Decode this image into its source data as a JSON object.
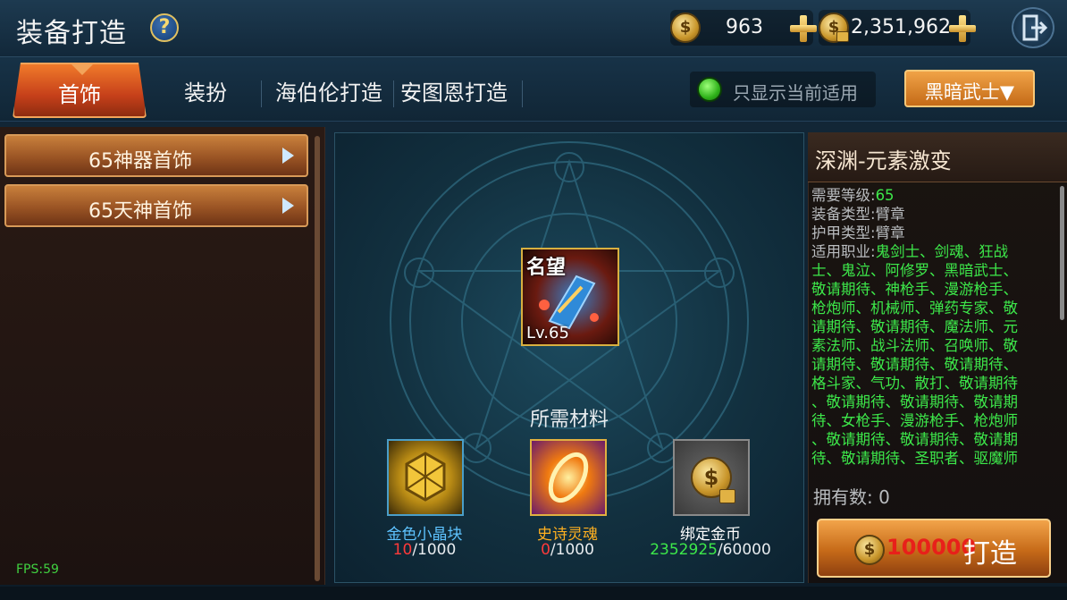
{
  "header": {
    "title": "装备打造",
    "help_icon": "?",
    "currency_gold": "963",
    "currency_bound_gold": "2,351,962",
    "coin_symbol": "$"
  },
  "tabs": [
    {
      "label": "首饰",
      "active": true
    },
    {
      "label": "装扮",
      "active": false
    },
    {
      "label": "海伯伦打造",
      "active": false
    },
    {
      "label": "安图恩打造",
      "active": false
    }
  ],
  "filter": {
    "label": "只显示当前适用",
    "checked": true
  },
  "class_select": {
    "value": "黑暗武士",
    "arrow": "▼"
  },
  "left_list": [
    {
      "label": "65神器首饰"
    },
    {
      "label": "65天神首饰"
    }
  ],
  "center": {
    "item_badge": "名望",
    "item_level": "Lv.65",
    "materials_title": "所需材料",
    "materials": [
      {
        "name": "金色小晶块",
        "owned": "10",
        "required": "/1000",
        "name_color": "#5ec3ff",
        "owned_color": "#ff3a3a"
      },
      {
        "name": "史诗灵魂",
        "owned": "0",
        "required": "/1000",
        "name_color": "#ffb020",
        "owned_color": "#ff3a3a"
      },
      {
        "name": "绑定金币",
        "owned": "2352925",
        "required": "/60000",
        "name_color": "#ffffff",
        "owned_color": "#3de84a"
      }
    ]
  },
  "detail": {
    "name": "深渊-元素激变",
    "required_level_label": "需要等级:",
    "required_level": "65",
    "equip_type_label": "装备类型:",
    "equip_type": "臂章",
    "armor_type_label": "护甲类型:",
    "armor_type": "臂章",
    "job_label": "适用职业:",
    "job_lines": [
      "鬼剑士、剑魂、狂战",
      "士、鬼泣、阿修罗、黑暗武士、",
      "敬请期待、神枪手、漫游枪手、",
      "枪炮师、机械师、弹药专家、敬",
      "请期待、敬请期待、魔法师、元",
      "素法师、战斗法师、召唤师、敬",
      "请期待、敬请期待、敬请期待、",
      "格斗家、气功、散打、敬请期待",
      "、敬请期待、敬请期待、敬请期",
      "待、女枪手、漫游枪手、枪炮师",
      "、敬请期待、敬请期待、敬请期",
      "待、敬请期待、圣职者、驱魔师"
    ],
    "owned_label": "拥有数:",
    "owned_value": "0",
    "forge_cost": "100000",
    "forge_label": "打造"
  },
  "fps": "FPS:59"
}
